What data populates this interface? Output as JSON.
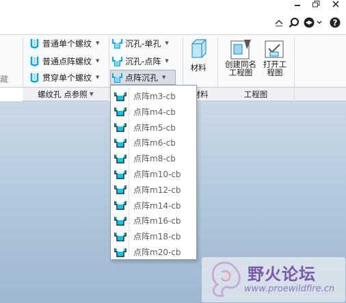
{
  "window_controls": {
    "minimize_icon": "minimize-icon",
    "restore_icon": "restore-icon",
    "close_icon": "close-icon"
  },
  "help_toolbar": {
    "items": [
      "collapse-ribbon-icon",
      "search-icon",
      "community-icon",
      "help-icon"
    ]
  },
  "ribbon": {
    "left_partial_label": "藏",
    "thread_group": {
      "buttons": [
        {
          "label": "普通单个螺纹"
        },
        {
          "label": "普通点阵螺纹"
        },
        {
          "label": "贯穿单个螺纹"
        }
      ],
      "footer": "螺纹孔 点参照"
    },
    "counterbore_group": {
      "buttons": [
        {
          "label": "沉孔-单孔"
        },
        {
          "label": "沉孔-点阵"
        },
        {
          "label": "点阵沉孔",
          "pressed": true
        }
      ]
    },
    "material_group": {
      "button_label": "材料",
      "footer": "材料"
    },
    "drawing_group": {
      "create_label_line1": "创建同名",
      "create_label_line2": "工程图",
      "open_label_line1": "打开工",
      "open_label_line2": "程图",
      "footer": "工程图"
    }
  },
  "dropdown": {
    "items": [
      {
        "label": "点阵m3-cb"
      },
      {
        "label": "点阵m4-cb"
      },
      {
        "label": "点阵m5-cb"
      },
      {
        "label": "点阵m6-cb"
      },
      {
        "label": "点阵m8-cb"
      },
      {
        "label": "点阵m10-cb"
      },
      {
        "label": "点阵m12-cb"
      },
      {
        "label": "点阵m14-cb"
      },
      {
        "label": "点阵m16-cb"
      },
      {
        "label": "点阵m18-cb"
      },
      {
        "label": "点阵m20-cb"
      }
    ]
  },
  "watermark": {
    "title": "野火论坛",
    "url": "www.proewildfire.cn"
  },
  "colors": {
    "accent": "#00b4e6",
    "ribbon_bg": "#f9fafc",
    "workspace_top": "#cad8e6",
    "workspace_bottom": "#9fb7d0",
    "watermark_text": "#7a5aa6"
  }
}
